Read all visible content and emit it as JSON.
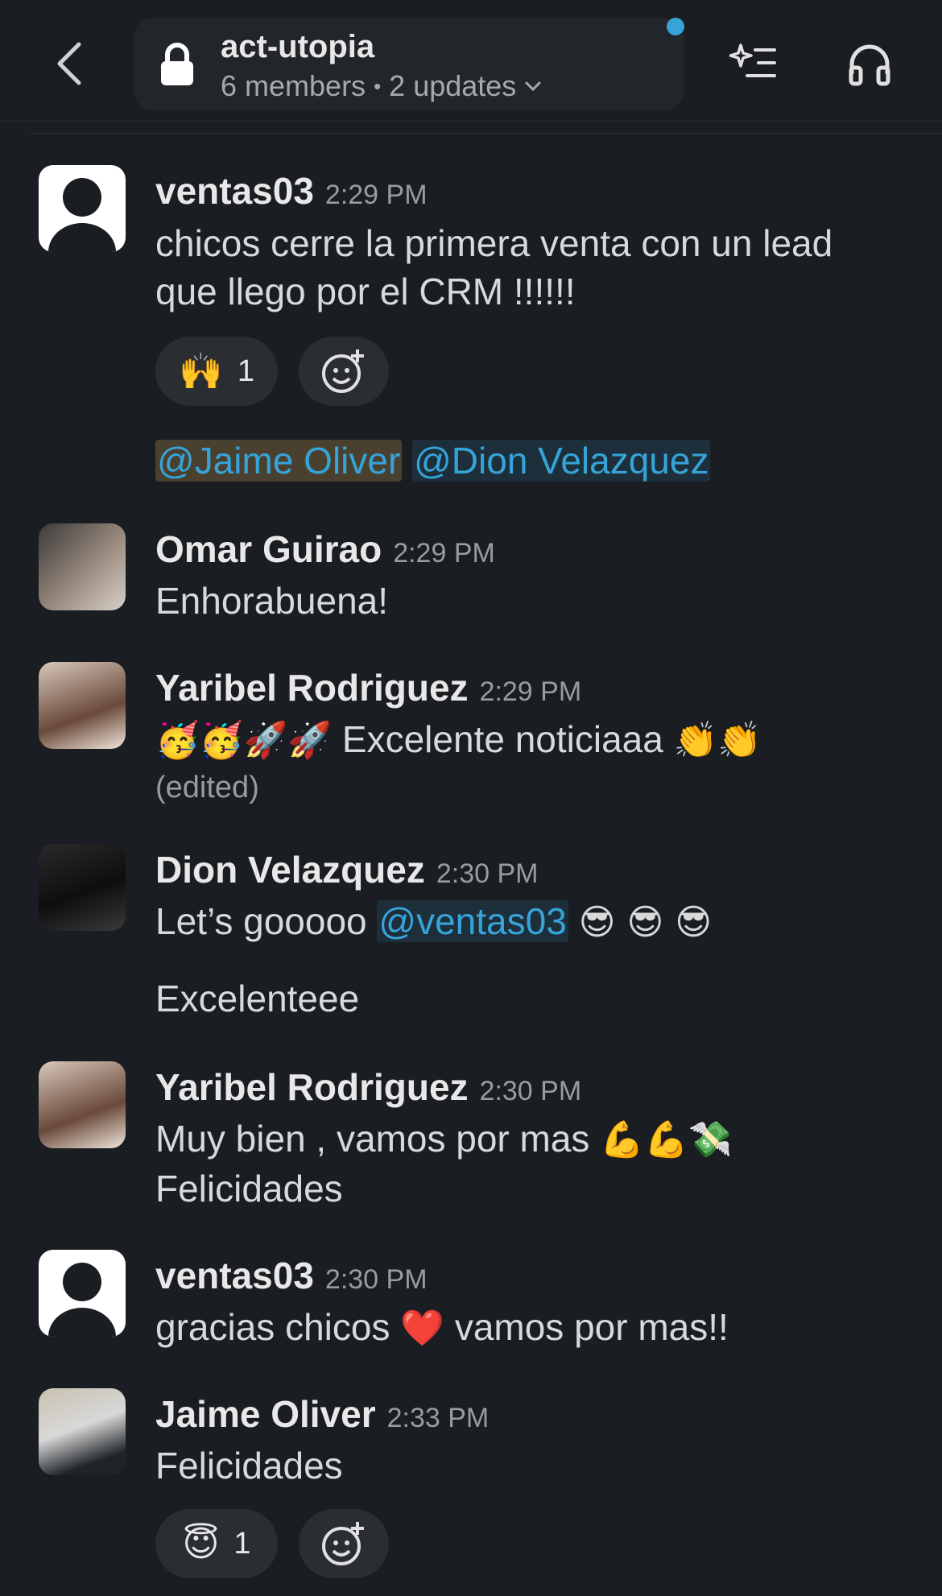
{
  "header": {
    "channel_name": "act-utopia",
    "members": "6 members",
    "updates": "2 updates",
    "separator": "•"
  },
  "colors": {
    "background": "#1a1d21",
    "mention": "#36a3d9",
    "notification_dot": "#36a3d9"
  },
  "messages": [
    {
      "author": "ventas03",
      "time": "2:29 PM",
      "text_line1": "chicos cerre la primera venta con un lead",
      "text_line2": "que llego por el CRM !!!!!!",
      "reaction": {
        "emoji": "🙌",
        "count": "1"
      },
      "mention1": "@Jaime Oliver",
      "mention2": "@Dion Velazquez"
    },
    {
      "author": "Omar Guirao",
      "time": "2:29 PM",
      "text": "Enhorabuena!"
    },
    {
      "author": "Yaribel Rodriguez",
      "time": "2:29 PM",
      "emoji_prefix": "🥳🥳🚀🚀",
      "text": "Excelente noticiaaa",
      "emoji_suffix": "👏👏",
      "edited": "(edited)"
    },
    {
      "author": "Dion Velazquez",
      "time": "2:30 PM",
      "text_prefix": "Let’s gooooo",
      "mention": "@ventas03",
      "emoji_suffix": "😎  😎  😎",
      "text2": "Excelenteee"
    },
    {
      "author": "Yaribel Rodriguez",
      "time": "2:30 PM",
      "text_line1": "Muy bien , vamos por mas",
      "emoji_suffix": "💪💪💸",
      "text_line2": "Felicidades"
    },
    {
      "author": "ventas03",
      "time": "2:30 PM",
      "text_prefix": "gracias chicos",
      "emoji": "❤️",
      "text_suffix": "vamos por mas!!"
    },
    {
      "author": "Jaime Oliver",
      "time": "2:33 PM",
      "text": "Felicidades",
      "reaction": {
        "emoji": "😇",
        "count": "1"
      }
    }
  ]
}
